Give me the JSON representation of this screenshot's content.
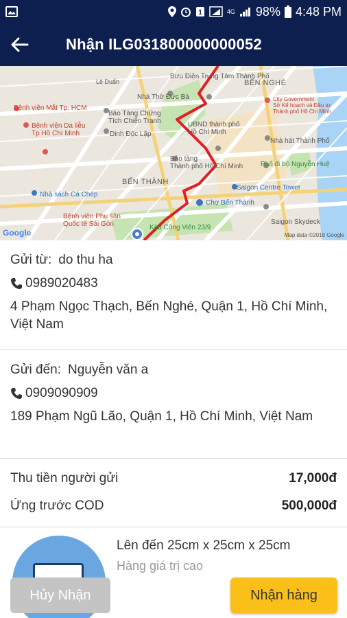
{
  "status_bar": {
    "battery": "98%",
    "time": "4:48 PM",
    "network": "4G"
  },
  "app_bar": {
    "title": "Nhận ILG031800000000052"
  },
  "map": {
    "labels": {
      "buu_dien": "Bưu Điện Trung\nTâm Thành Phố",
      "ben_nghe": "BẾN NGHÉ",
      "city_gov": "City Government\nSở Kế hoạch và Đầu tư\nThành phố Hồ Chí Minh",
      "benh_vien_mat": "Bệnh viện Mắt Tp. HCM",
      "nha_tho": "Nhà Thờ Đức Bà",
      "bao_tang_chung_tich": "Bảo Tàng Chứng\nTích Chiến Tranh",
      "benh_vien_da_lieu": "Bệnh viện Da liễu\nTp Hồ Chí Minh",
      "dinh_doc_lap": "Dinh Độc Lập",
      "ubnd": "UBND thành phố\nHồ Chí Minh",
      "nha_hat": "Nhà hát Thành Phố",
      "bao_tang_hcm": "Bảo tàng\nThành phố Hồ Chí Minh",
      "pho_di_bo": "Phố đi bộ Nguyễn Huệ",
      "ben_thanh": "BẾN THÀNH",
      "saigon_centre": "Saigon Centre Tower",
      "nha_sach": "Nhà sách Cá Chép",
      "cho_ben_thanh": "Chợ Bến Thành",
      "benh_vien_phu_san": "Bệnh viện Phụ sản\nQuốc tế Sài Gòn",
      "saigon_skydeck": "Saigon Skydeck",
      "kau": "Kàu Cổng Viên 23/9",
      "le_duan": "Lê Duẩn",
      "google": "Google",
      "credit": "Map data ©2018 Google"
    }
  },
  "sender": {
    "label": "Gửi từ:",
    "name": "do thu ha",
    "phone": "0989020483",
    "address": "4 Phạm Ngọc Thạch, Bến Nghé, Quận 1, Hồ Chí Minh, Việt Nam"
  },
  "receiver": {
    "label": "Gửi đến:",
    "name": "Nguyễn văn a",
    "phone": "0909090909",
    "address": "189 Phạm Ngũ Lão, Quận 1, Hồ Chí Minh, Việt Nam"
  },
  "fees": {
    "sender_charge_label": "Thu tiền người gửi",
    "sender_charge_value": "17,000đ",
    "cod_label": "Ứng trước COD",
    "cod_value": "500,000đ"
  },
  "package": {
    "size": "Lên đến 25cm x 25cm x 25cm",
    "description": "Hàng giá trị cao"
  },
  "actions": {
    "cancel_label": "Hủy Nhận",
    "accept_label": "Nhận hàng"
  },
  "colors": {
    "header": "#0c1f4f",
    "accent": "#fbbf1a",
    "disabled": "#c4c4c4",
    "route": "#e02020"
  }
}
